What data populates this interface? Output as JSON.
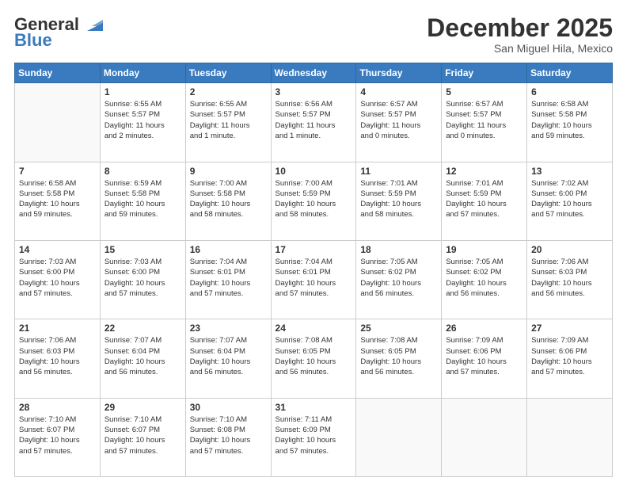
{
  "logo": {
    "text1": "General",
    "text2": "Blue"
  },
  "title": "December 2025",
  "location": "San Miguel Hila, Mexico",
  "days_header": [
    "Sunday",
    "Monday",
    "Tuesday",
    "Wednesday",
    "Thursday",
    "Friday",
    "Saturday"
  ],
  "weeks": [
    [
      {
        "day": "",
        "info": ""
      },
      {
        "day": "1",
        "info": "Sunrise: 6:55 AM\nSunset: 5:57 PM\nDaylight: 11 hours\nand 2 minutes."
      },
      {
        "day": "2",
        "info": "Sunrise: 6:55 AM\nSunset: 5:57 PM\nDaylight: 11 hours\nand 1 minute."
      },
      {
        "day": "3",
        "info": "Sunrise: 6:56 AM\nSunset: 5:57 PM\nDaylight: 11 hours\nand 1 minute."
      },
      {
        "day": "4",
        "info": "Sunrise: 6:57 AM\nSunset: 5:57 PM\nDaylight: 11 hours\nand 0 minutes."
      },
      {
        "day": "5",
        "info": "Sunrise: 6:57 AM\nSunset: 5:57 PM\nDaylight: 11 hours\nand 0 minutes."
      },
      {
        "day": "6",
        "info": "Sunrise: 6:58 AM\nSunset: 5:58 PM\nDaylight: 10 hours\nand 59 minutes."
      }
    ],
    [
      {
        "day": "7",
        "info": "Sunrise: 6:58 AM\nSunset: 5:58 PM\nDaylight: 10 hours\nand 59 minutes."
      },
      {
        "day": "8",
        "info": "Sunrise: 6:59 AM\nSunset: 5:58 PM\nDaylight: 10 hours\nand 59 minutes."
      },
      {
        "day": "9",
        "info": "Sunrise: 7:00 AM\nSunset: 5:58 PM\nDaylight: 10 hours\nand 58 minutes."
      },
      {
        "day": "10",
        "info": "Sunrise: 7:00 AM\nSunset: 5:59 PM\nDaylight: 10 hours\nand 58 minutes."
      },
      {
        "day": "11",
        "info": "Sunrise: 7:01 AM\nSunset: 5:59 PM\nDaylight: 10 hours\nand 58 minutes."
      },
      {
        "day": "12",
        "info": "Sunrise: 7:01 AM\nSunset: 5:59 PM\nDaylight: 10 hours\nand 57 minutes."
      },
      {
        "day": "13",
        "info": "Sunrise: 7:02 AM\nSunset: 6:00 PM\nDaylight: 10 hours\nand 57 minutes."
      }
    ],
    [
      {
        "day": "14",
        "info": "Sunrise: 7:03 AM\nSunset: 6:00 PM\nDaylight: 10 hours\nand 57 minutes."
      },
      {
        "day": "15",
        "info": "Sunrise: 7:03 AM\nSunset: 6:00 PM\nDaylight: 10 hours\nand 57 minutes."
      },
      {
        "day": "16",
        "info": "Sunrise: 7:04 AM\nSunset: 6:01 PM\nDaylight: 10 hours\nand 57 minutes."
      },
      {
        "day": "17",
        "info": "Sunrise: 7:04 AM\nSunset: 6:01 PM\nDaylight: 10 hours\nand 57 minutes."
      },
      {
        "day": "18",
        "info": "Sunrise: 7:05 AM\nSunset: 6:02 PM\nDaylight: 10 hours\nand 56 minutes."
      },
      {
        "day": "19",
        "info": "Sunrise: 7:05 AM\nSunset: 6:02 PM\nDaylight: 10 hours\nand 56 minutes."
      },
      {
        "day": "20",
        "info": "Sunrise: 7:06 AM\nSunset: 6:03 PM\nDaylight: 10 hours\nand 56 minutes."
      }
    ],
    [
      {
        "day": "21",
        "info": "Sunrise: 7:06 AM\nSunset: 6:03 PM\nDaylight: 10 hours\nand 56 minutes."
      },
      {
        "day": "22",
        "info": "Sunrise: 7:07 AM\nSunset: 6:04 PM\nDaylight: 10 hours\nand 56 minutes."
      },
      {
        "day": "23",
        "info": "Sunrise: 7:07 AM\nSunset: 6:04 PM\nDaylight: 10 hours\nand 56 minutes."
      },
      {
        "day": "24",
        "info": "Sunrise: 7:08 AM\nSunset: 6:05 PM\nDaylight: 10 hours\nand 56 minutes."
      },
      {
        "day": "25",
        "info": "Sunrise: 7:08 AM\nSunset: 6:05 PM\nDaylight: 10 hours\nand 56 minutes."
      },
      {
        "day": "26",
        "info": "Sunrise: 7:09 AM\nSunset: 6:06 PM\nDaylight: 10 hours\nand 57 minutes."
      },
      {
        "day": "27",
        "info": "Sunrise: 7:09 AM\nSunset: 6:06 PM\nDaylight: 10 hours\nand 57 minutes."
      }
    ],
    [
      {
        "day": "28",
        "info": "Sunrise: 7:10 AM\nSunset: 6:07 PM\nDaylight: 10 hours\nand 57 minutes."
      },
      {
        "day": "29",
        "info": "Sunrise: 7:10 AM\nSunset: 6:07 PM\nDaylight: 10 hours\nand 57 minutes."
      },
      {
        "day": "30",
        "info": "Sunrise: 7:10 AM\nSunset: 6:08 PM\nDaylight: 10 hours\nand 57 minutes."
      },
      {
        "day": "31",
        "info": "Sunrise: 7:11 AM\nSunset: 6:09 PM\nDaylight: 10 hours\nand 57 minutes."
      },
      {
        "day": "",
        "info": ""
      },
      {
        "day": "",
        "info": ""
      },
      {
        "day": "",
        "info": ""
      }
    ]
  ]
}
